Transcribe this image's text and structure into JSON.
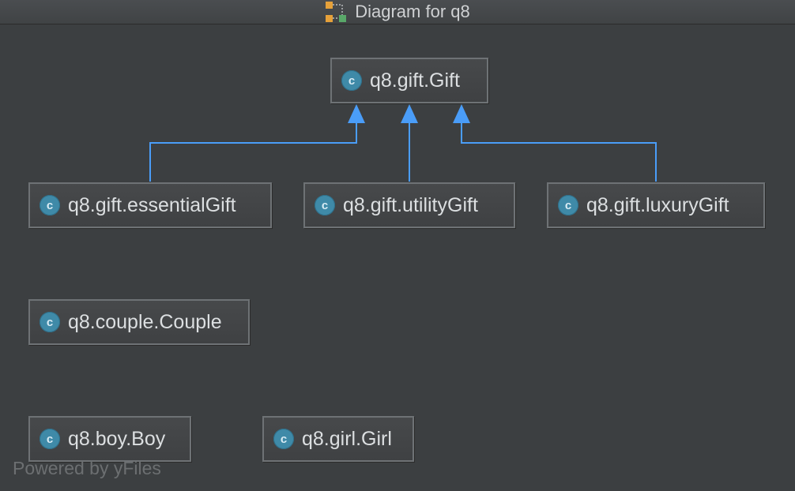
{
  "window": {
    "title": "Diagram for q8"
  },
  "diagram": {
    "class_icon_letter": "c",
    "nodes": [
      {
        "id": "gift",
        "label": "q8.gift.Gift"
      },
      {
        "id": "essential",
        "label": "q8.gift.essentialGift"
      },
      {
        "id": "utility",
        "label": "q8.gift.utilityGift"
      },
      {
        "id": "luxury",
        "label": "q8.gift.luxuryGift"
      },
      {
        "id": "couple",
        "label": "q8.couple.Couple"
      },
      {
        "id": "boy",
        "label": "q8.boy.Boy"
      },
      {
        "id": "girl",
        "label": "q8.girl.Girl"
      }
    ],
    "edges": [
      {
        "from": "essential",
        "to": "gift",
        "type": "inheritance"
      },
      {
        "from": "utility",
        "to": "gift",
        "type": "inheritance"
      },
      {
        "from": "luxury",
        "to": "gift",
        "type": "inheritance"
      }
    ],
    "edge_color": "#4a9df8"
  },
  "footer": {
    "watermark": "Powered by yFiles"
  },
  "colors": {
    "background": "#3c3f41",
    "node_border": "#6e7275",
    "class_icon": "#3f8aa8"
  }
}
